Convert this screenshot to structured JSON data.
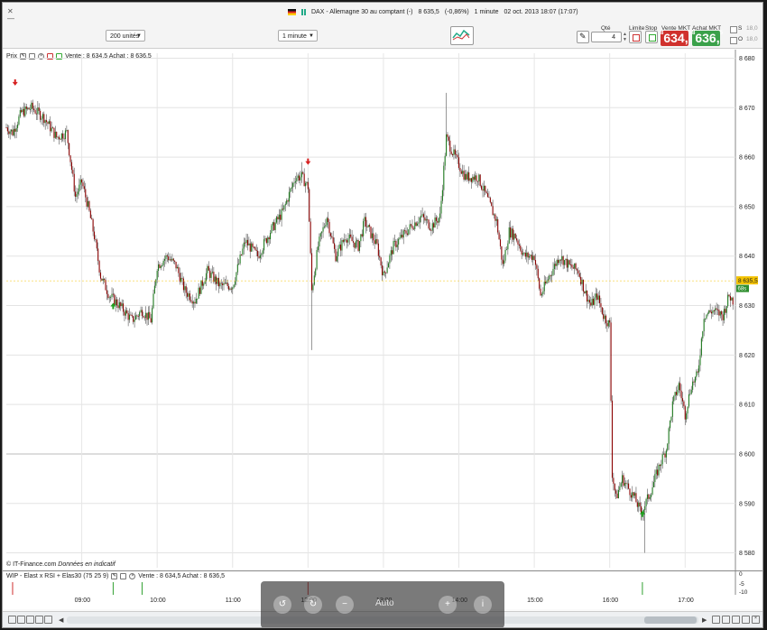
{
  "window": {
    "title": "DAX - Allemagne 30 au comptant (-)",
    "price": "8 635,5",
    "change": "(-0,86%)",
    "timeframe": "1 minute",
    "datetime": "02 oct. 2013 18:07 (17:07)"
  },
  "toolbar": {
    "units_select": "200 unités",
    "interval_select": "1 minute",
    "qty_label": "Qté",
    "qty_value": "4",
    "limit_label": "Limite",
    "stop_label": "Stop",
    "sell_label": "Vente MKT",
    "buy_label": "Achat MKT",
    "sell_main": "634,",
    "sell_frac": "5",
    "sell_prefix": "8",
    "buy_main": "636,",
    "buy_frac": "5",
    "buy_prefix": "8",
    "s_label": "S",
    "o_label": "O",
    "side_val_1": "18,0",
    "side_val_2": "18,0"
  },
  "chart_legend": {
    "label": "Prix",
    "quote": "Vente : 8 634,5 Achat : 8 636,5"
  },
  "indicator": {
    "name": "WIP - Elast x RSI + Elas30 (75 25 9)",
    "quote": "Vente : 8 634,5 Achat : 8 636,5",
    "axis": [
      "0",
      "-5",
      "-10"
    ]
  },
  "footer": {
    "source": "© IT-Finance.com",
    "disclaimer": "Données en indicatif"
  },
  "price_tag": {
    "value": "8 635,5",
    "sub": "68s"
  },
  "overlay": {
    "auto_label": "Auto"
  },
  "colors": {
    "bull": "#1f7a1f",
    "bear": "#8b0000",
    "sell": "#d0312d",
    "buy": "#3aa14a",
    "arrow_down": "#d62020",
    "arrow_up": "#20a020"
  },
  "chart_data": {
    "type": "candlestick",
    "y_ticks": [
      "8 680",
      "8 670",
      "8 660",
      "8 650",
      "8 640",
      "8 630",
      "8 620",
      "8 610",
      "8 600",
      "8 590",
      "8 580"
    ],
    "x_ticks": [
      "09:00",
      "10:00",
      "11:00",
      "12:00",
      "13:00",
      "14:00",
      "15:00",
      "16:00",
      "17:00"
    ],
    "ylim": [
      8577,
      8681
    ],
    "x_range": [
      "08:00",
      "17:40"
    ],
    "grid": true,
    "close_path": [
      [
        "08:00",
        8666
      ],
      [
        "08:05",
        8665
      ],
      [
        "08:12",
        8669
      ],
      [
        "08:20",
        8670
      ],
      [
        "08:30",
        8668
      ],
      [
        "08:40",
        8664
      ],
      [
        "08:48",
        8665
      ],
      [
        "08:55",
        8652
      ],
      [
        "09:00",
        8655
      ],
      [
        "09:05",
        8650
      ],
      [
        "09:10",
        8644
      ],
      [
        "09:15",
        8636
      ],
      [
        "09:22",
        8632
      ],
      [
        "09:30",
        8630
      ],
      [
        "09:40",
        8627
      ],
      [
        "09:48",
        8629
      ],
      [
        "09:55",
        8627
      ],
      [
        "10:00",
        8638
      ],
      [
        "10:08",
        8640
      ],
      [
        "10:15",
        8638
      ],
      [
        "10:22",
        8633
      ],
      [
        "10:30",
        8631
      ],
      [
        "10:40",
        8637
      ],
      [
        "10:50",
        8634
      ],
      [
        "11:00",
        8634
      ],
      [
        "11:10",
        8643
      ],
      [
        "11:20",
        8640
      ],
      [
        "11:30",
        8645
      ],
      [
        "11:40",
        8649
      ],
      [
        "11:50",
        8656
      ],
      [
        "11:55",
        8656
      ],
      [
        "12:00",
        8654
      ],
      [
        "12:03",
        8633
      ],
      [
        "12:08",
        8642
      ],
      [
        "12:15",
        8648
      ],
      [
        "12:22",
        8640
      ],
      [
        "12:30",
        8644
      ],
      [
        "12:40",
        8642
      ],
      [
        "12:45",
        8647
      ],
      [
        "12:55",
        8642
      ],
      [
        "13:00",
        8636
      ],
      [
        "13:08",
        8642
      ],
      [
        "13:15",
        8644
      ],
      [
        "13:22",
        8646
      ],
      [
        "13:30",
        8648
      ],
      [
        "13:38",
        8646
      ],
      [
        "13:45",
        8648
      ],
      [
        "13:50",
        8664
      ],
      [
        "13:55",
        8661
      ],
      [
        "14:05",
        8656
      ],
      [
        "14:15",
        8656
      ],
      [
        "14:22",
        8652
      ],
      [
        "14:30",
        8647
      ],
      [
        "14:35",
        8638
      ],
      [
        "14:40",
        8645
      ],
      [
        "14:45",
        8644
      ],
      [
        "14:52",
        8640
      ],
      [
        "15:00",
        8640
      ],
      [
        "15:05",
        8632
      ],
      [
        "15:12",
        8636
      ],
      [
        "15:20",
        8640
      ],
      [
        "15:28",
        8638
      ],
      [
        "15:35",
        8637
      ],
      [
        "15:40",
        8633
      ],
      [
        "15:45",
        8630
      ],
      [
        "15:50",
        8632
      ],
      [
        "15:55",
        8628
      ],
      [
        "16:00",
        8626
      ],
      [
        "16:02",
        8596
      ],
      [
        "16:05",
        8591
      ],
      [
        "16:10",
        8595
      ],
      [
        "16:15",
        8593
      ],
      [
        "16:20",
        8591
      ],
      [
        "16:25",
        8588
      ],
      [
        "16:32",
        8592
      ],
      [
        "16:40",
        8598
      ],
      [
        "16:45",
        8601
      ],
      [
        "16:50",
        8610
      ],
      [
        "16:55",
        8614
      ],
      [
        "17:00",
        8608
      ],
      [
        "17:05",
        8614
      ],
      [
        "17:10",
        8616
      ],
      [
        "17:15",
        8628
      ],
      [
        "17:22",
        8629
      ],
      [
        "17:30",
        8628
      ],
      [
        "17:35",
        8632
      ],
      [
        "17:38",
        8631
      ]
    ],
    "signals": [
      {
        "time": "08:07",
        "price": 8675,
        "direction": "down"
      },
      {
        "time": "09:25",
        "price": 8630,
        "direction": "up"
      },
      {
        "time": "12:00",
        "price": 8659,
        "direction": "down"
      },
      {
        "time": "16:26",
        "price": 8588,
        "direction": "up"
      }
    ]
  }
}
